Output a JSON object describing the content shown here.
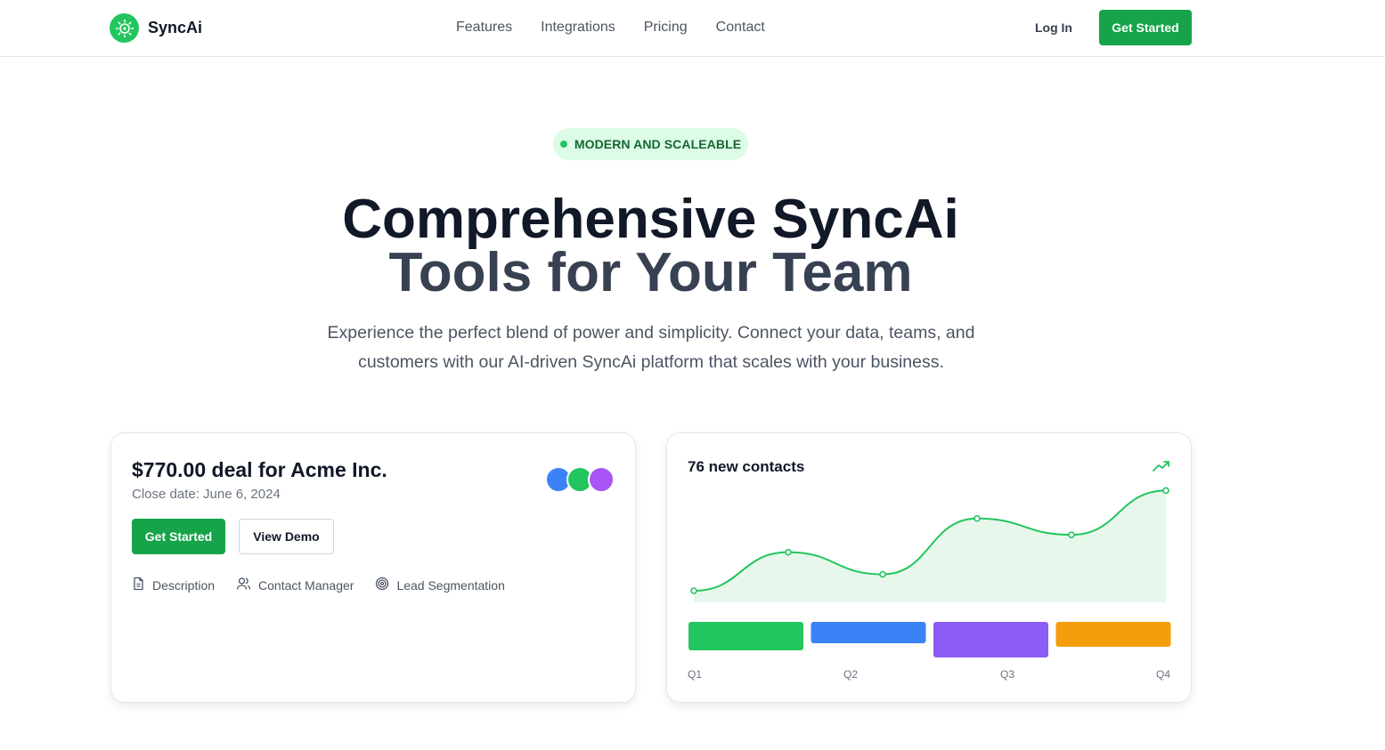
{
  "brand": {
    "name": "SyncAi",
    "logo_icon": "sun-gear-icon",
    "accent": "#22c55e",
    "button_color": "#16a34a"
  },
  "nav": {
    "items": [
      "Features",
      "Integrations",
      "Pricing",
      "Contact"
    ]
  },
  "header_actions": {
    "login": "Log In",
    "cta": "Get Started"
  },
  "hero": {
    "badge": "MODERN AND SCALEABLE",
    "title_line1": "Comprehensive SyncAi",
    "title_line2": "Tools for Your Team",
    "subtitle_line1": "Experience the perfect blend of power and simplicity. Connect your data, teams, and",
    "subtitle_line2": "customers with our AI-driven SyncAi platform that scales with your business."
  },
  "deal_card": {
    "title": "$770.00 deal for Acme Inc.",
    "close_date": "Close date: June 6, 2024",
    "avatar_colors": [
      "#3b82f6",
      "#22c55e",
      "#a855f7"
    ],
    "primary_button": "Get Started",
    "secondary_button": "View Demo",
    "features": [
      {
        "label": "Description",
        "icon": "document-icon"
      },
      {
        "label": "Contact Manager",
        "icon": "users-icon"
      },
      {
        "label": "Lead Segmentation",
        "icon": "target-icon"
      }
    ]
  },
  "contacts_card": {
    "title": "76 new contacts",
    "trend_icon": "trending-up-icon"
  },
  "chart_data": {
    "type": "area",
    "categories": [
      "Q1",
      "Q2",
      "Q3",
      "Q4"
    ],
    "line_values": [
      12,
      52,
      29,
      87,
      70,
      116
    ],
    "bar_values": [
      32,
      24,
      40,
      28
    ],
    "bar_colors": [
      "#22c55e",
      "#3b82f6",
      "#8b5cf6",
      "#f59e0b"
    ],
    "line_color": "#22c55e",
    "fill_color": "#e8f7ec",
    "ylim": [
      0,
      120
    ],
    "bar_max": 40,
    "grid": false,
    "title": "",
    "xlabel": "",
    "ylabel": ""
  }
}
